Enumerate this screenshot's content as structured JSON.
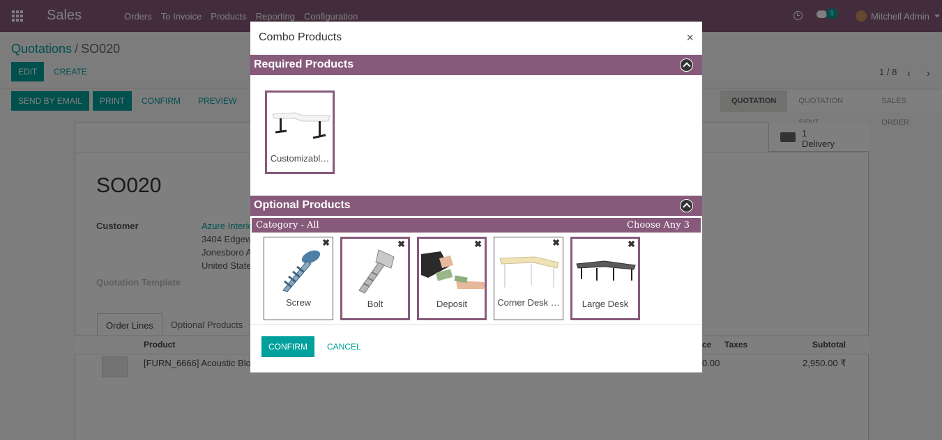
{
  "navbar": {
    "brand": "Sales",
    "menu": [
      "Orders",
      "To Invoice",
      "Products",
      "Reporting",
      "Configuration"
    ],
    "chat_count": "1",
    "user": "Mitchell Admin"
  },
  "breadcrumb": {
    "parent": "Quotations",
    "separator": "/",
    "current": "SO020"
  },
  "actions": {
    "edit": "EDIT",
    "create": "CREATE",
    "send_email": "SEND BY EMAIL",
    "print": "PRINT",
    "confirm": "CONFIRM",
    "preview": "PREVIEW"
  },
  "pager": {
    "text": "1 / 8"
  },
  "status": [
    "QUOTATION",
    "QUOTATION SENT",
    "SALES ORDER"
  ],
  "sheet": {
    "delivery_count": "1",
    "delivery_label": "Delivery",
    "title": "SO020",
    "customer_label": "Customer",
    "customer_name": "Azure Interio",
    "address": [
      "3404 Edgew",
      "Jonesboro A",
      "United State"
    ],
    "template_label": "Quotation Template",
    "tabs": [
      "Order Lines",
      "Optional Products"
    ],
    "columns": {
      "product": "Product",
      "price": "ce",
      "taxes": "Taxes",
      "subtotal": "Subtotal"
    },
    "row": {
      "product": "[FURN_6666] Acoustic Blo",
      "price": "0.00",
      "subtotal": "2,950.00 ₹"
    }
  },
  "modal": {
    "title": "Combo Products",
    "close": "×",
    "required_title": "Required Products",
    "required_products": [
      {
        "name": "Customizabl…",
        "selected": true
      }
    ],
    "optional_title": "Optional Products",
    "category_label": "Category - All",
    "choose_label": "Choose Any 3",
    "optional_products": [
      {
        "name": "Screw",
        "selected": false
      },
      {
        "name": "Bolt",
        "selected": true
      },
      {
        "name": "Deposit",
        "selected": true
      },
      {
        "name": "Corner Desk …",
        "selected": false
      },
      {
        "name": "Large Desk",
        "selected": true
      }
    ],
    "remove_symbol": "✖",
    "confirm": "CONFIRM",
    "cancel": "CANCEL"
  },
  "colors": {
    "brand": "#875a7b",
    "accent": "#00a09d"
  }
}
